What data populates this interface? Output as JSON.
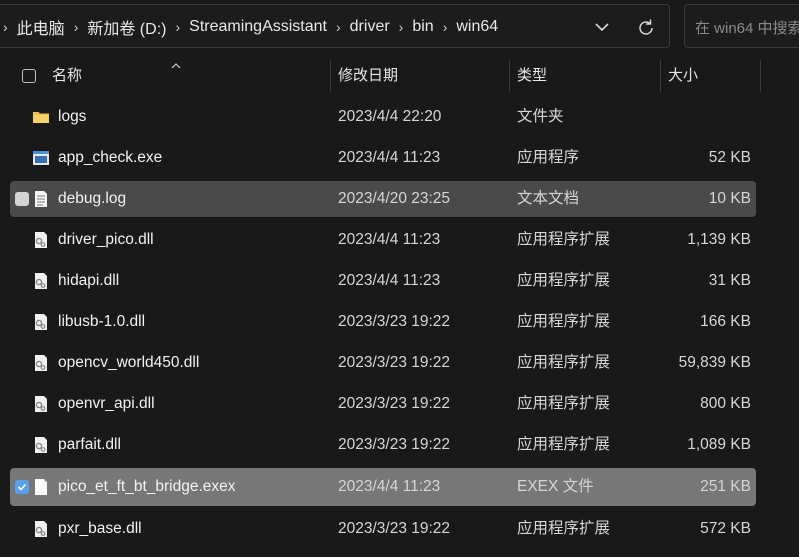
{
  "address": {
    "crumbs": [
      "此电脑",
      "新加卷 (D:)",
      "StreamingAssistant",
      "driver",
      "bin",
      "win64"
    ]
  },
  "search": {
    "placeholder": "在 win64 中搜索"
  },
  "columns": {
    "name": "名称",
    "date": "修改日期",
    "type": "类型",
    "size": "大小"
  },
  "files": [
    {
      "icon": "folder-icon",
      "name": "logs",
      "date": "2023/4/4 22:20",
      "type": "文件夹",
      "size": ""
    },
    {
      "icon": "exe-icon",
      "name": "app_check.exe",
      "date": "2023/4/4 11:23",
      "type": "应用程序",
      "size": "52 KB"
    },
    {
      "icon": "text-file-icon",
      "name": "debug.log",
      "date": "2023/4/20 23:25",
      "type": "文本文档",
      "size": "10 KB",
      "state": "hover"
    },
    {
      "icon": "dll-icon",
      "name": "driver_pico.dll",
      "date": "2023/4/4 11:23",
      "type": "应用程序扩展",
      "size": "1,139 KB"
    },
    {
      "icon": "dll-icon",
      "name": "hidapi.dll",
      "date": "2023/4/4 11:23",
      "type": "应用程序扩展",
      "size": "31 KB"
    },
    {
      "icon": "dll-icon",
      "name": "libusb-1.0.dll",
      "date": "2023/3/23 19:22",
      "type": "应用程序扩展",
      "size": "166 KB"
    },
    {
      "icon": "dll-icon",
      "name": "opencv_world450.dll",
      "date": "2023/3/23 19:22",
      "type": "应用程序扩展",
      "size": "59,839 KB"
    },
    {
      "icon": "dll-icon",
      "name": "openvr_api.dll",
      "date": "2023/3/23 19:22",
      "type": "应用程序扩展",
      "size": "800 KB"
    },
    {
      "icon": "dll-icon",
      "name": "parfait.dll",
      "date": "2023/3/23 19:22",
      "type": "应用程序扩展",
      "size": "1,089 KB"
    },
    {
      "icon": "blank-file-icon",
      "name": "pico_et_ft_bt_bridge.exex",
      "date": "2023/4/4 11:23",
      "type": "EXEX 文件",
      "size": "251 KB",
      "state": "selected"
    },
    {
      "icon": "dll-icon",
      "name": "pxr_base.dll",
      "date": "2023/3/23 19:22",
      "type": "应用程序扩展",
      "size": "572 KB"
    }
  ],
  "colors": {
    "background": "#191919",
    "hover": "#4a4a4a",
    "selected": "#777777",
    "accent": "#5aa0e6",
    "folder": "#f0c14b"
  }
}
